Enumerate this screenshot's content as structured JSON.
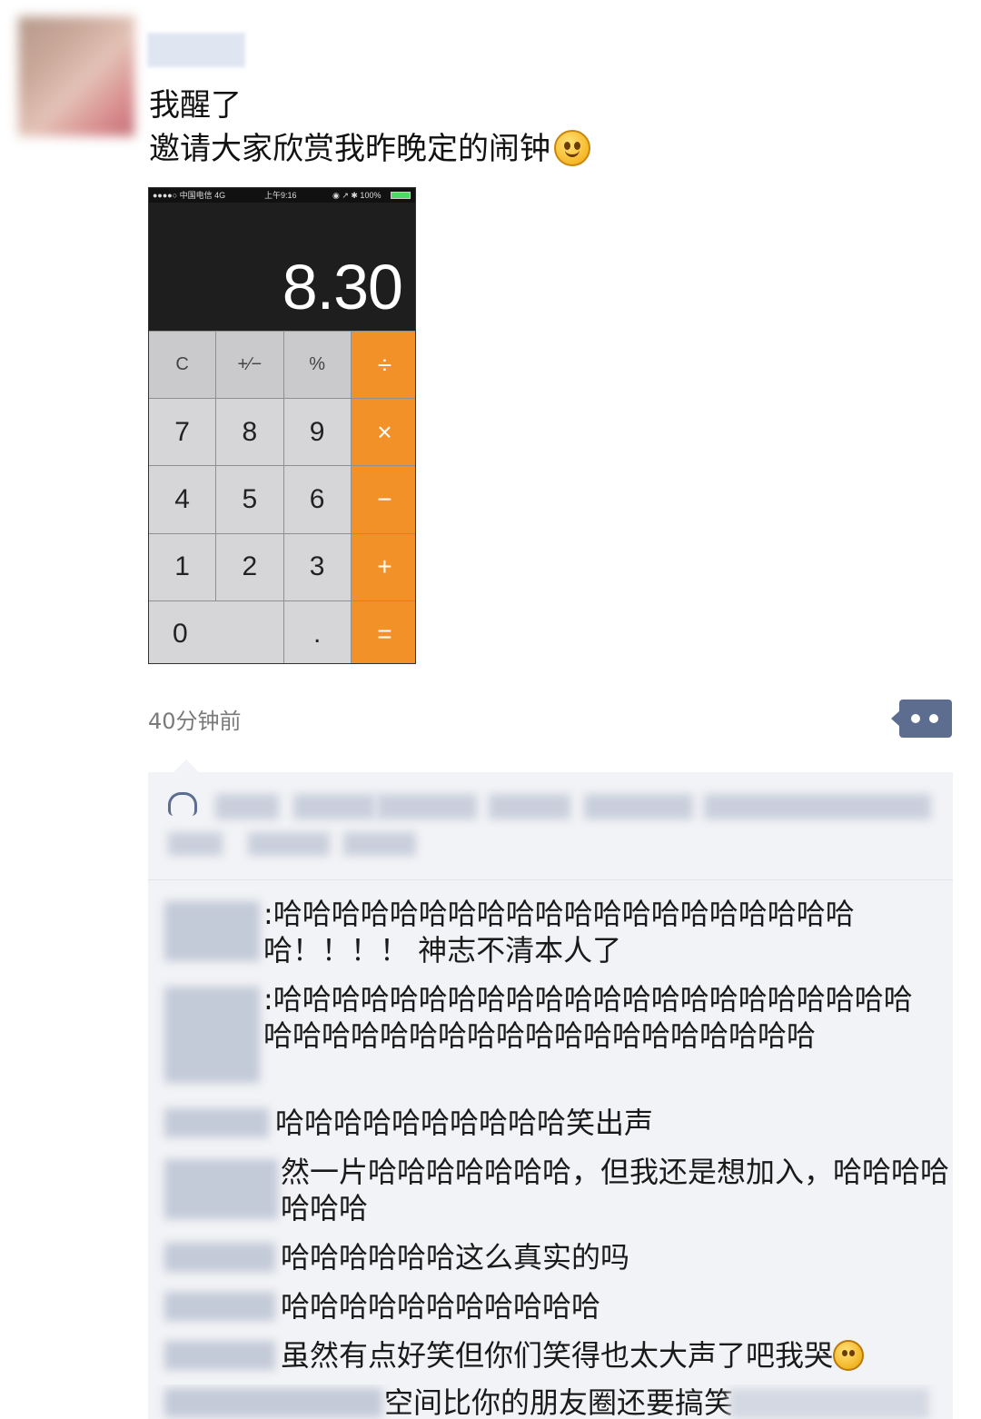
{
  "post": {
    "line1": "我醒了",
    "line2": "邀请大家欣赏我昨晚定的闹钟",
    "time": "40分钟前"
  },
  "screenshot": {
    "status_carrier": "●●●●○ 中国电信  4G",
    "status_time": "上午9:16",
    "status_right": "◉ ↗ ✱ 100%",
    "display_value": "8.30",
    "keys": [
      "C",
      "+∕−",
      "%",
      "÷",
      "7",
      "8",
      "9",
      "×",
      "4",
      "5",
      "6",
      "−",
      "1",
      "2",
      "3",
      "+",
      "0",
      ".",
      "="
    ]
  },
  "comments": [
    {
      "text": ":哈哈哈哈哈哈哈哈哈哈哈哈哈哈哈哈哈哈哈哈哈！！！！ 神志不清本人了"
    },
    {
      "text": ":哈哈哈哈哈哈哈哈哈哈哈哈哈哈哈哈哈哈哈哈哈哈哈哈哈哈哈哈哈哈哈哈哈哈哈哈哈哈哈哈哈"
    },
    {
      "text": "哈哈哈哈哈哈哈哈哈哈笑出声"
    },
    {
      "text": "然一片哈哈哈哈哈哈哈，但我还是想加入，哈哈哈哈哈哈哈"
    },
    {
      "text": "哈哈哈哈哈哈这么真实的吗"
    },
    {
      "text": "哈哈哈哈哈哈哈哈哈哈哈"
    },
    {
      "text": "虽然有点好笑但你们笑得也太大声了吧我哭"
    },
    {
      "text": "空间比你的朋友圈还要搞笑"
    }
  ],
  "icons": {
    "smile": "smile-emoji",
    "more": "more-dots-icon",
    "like": "heart-like-icon"
  },
  "colors": {
    "operator_orange": "#f39129",
    "wechat_link_blue": "#5c6d8f",
    "comment_panel_bg": "#f2f3f6"
  }
}
